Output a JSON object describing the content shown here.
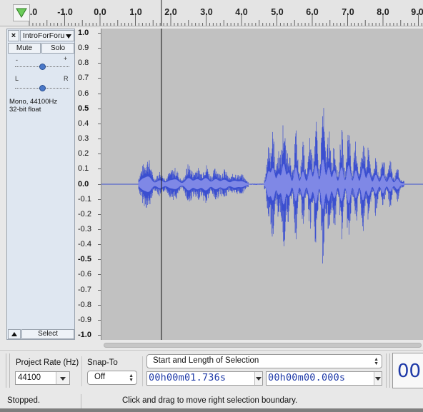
{
  "ruler": {
    "ticks": [
      "-1.0",
      "0.0",
      "1.0",
      "2.0",
      "3.0",
      "4.0",
      "5.0",
      "6.0",
      "7.0",
      "8.0",
      "9.0"
    ],
    "partial_left_tick": ".0"
  },
  "track": {
    "close_glyph": "×",
    "name": "IntroForForu",
    "mute_label": "Mute",
    "solo_label": "Solo",
    "gain_minus": "-",
    "gain_plus": "+",
    "pan_left": "L",
    "pan_right": "R",
    "gain_level": 0.5,
    "pan_level": 0.5,
    "info_line1": "Mono, 44100Hz",
    "info_line2": "32-bit float",
    "select_label": "Select"
  },
  "vertical_ruler": {
    "labels": [
      "1.0",
      "0.9",
      "0.8",
      "0.7",
      "0.6",
      "0.5",
      "0.4",
      "0.3",
      "0.2",
      "0.1",
      "0.0",
      "-0.1",
      "-0.2",
      "-0.3",
      "-0.4",
      "-0.5",
      "-0.6",
      "-0.7",
      "-0.8",
      "-0.9",
      "-1.0"
    ],
    "major": [
      "1.0",
      "0.5",
      "0.0",
      "-0.5",
      "-1.0"
    ]
  },
  "waveform": {
    "color": "#3b4fd0",
    "background": "#c1c1c1",
    "cursor_time_seconds": 1.736,
    "icons": [
      "play-head-triangle-icon"
    ]
  },
  "toolbar": {
    "project_rate_label": "Project Rate (Hz)",
    "project_rate_value": "44100",
    "snap_to_label": "Snap-To",
    "snap_to_value": "Off",
    "selection_mode": "Start and Length of Selection",
    "start_time": "00h00m01.736s",
    "length_time": "00h00m00.000s",
    "big_time_partial": "00"
  },
  "status": {
    "state": "Stopped.",
    "message": "Click and drag to move right selection boundary."
  }
}
